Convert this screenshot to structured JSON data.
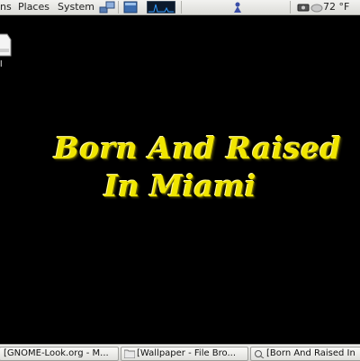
{
  "top_panel": {
    "menus": {
      "applications": "ns",
      "places": "Places",
      "system": "System"
    },
    "weather": "72 °F",
    "icons": [
      "network-icon",
      "show-desktop-icon",
      "system-monitor-icon",
      "help-icon",
      "volume-icon",
      "weather-cloud-icon"
    ]
  },
  "desktop": {
    "icon_label": "l",
    "wallpaper_text": {
      "line1": "Born And Raised",
      "line2": "In Miami"
    }
  },
  "taskbar": {
    "tasks": [
      {
        "label": "[GNOME-Look.org - M..."
      },
      {
        "label": "[Wallpaper - File Bro..."
      },
      {
        "label": "[Born And Raised In"
      }
    ]
  },
  "colors": {
    "wallpaper_bg": "#000000",
    "wallpaper_text": "#f0e600",
    "panel": "#dcdcd8"
  }
}
